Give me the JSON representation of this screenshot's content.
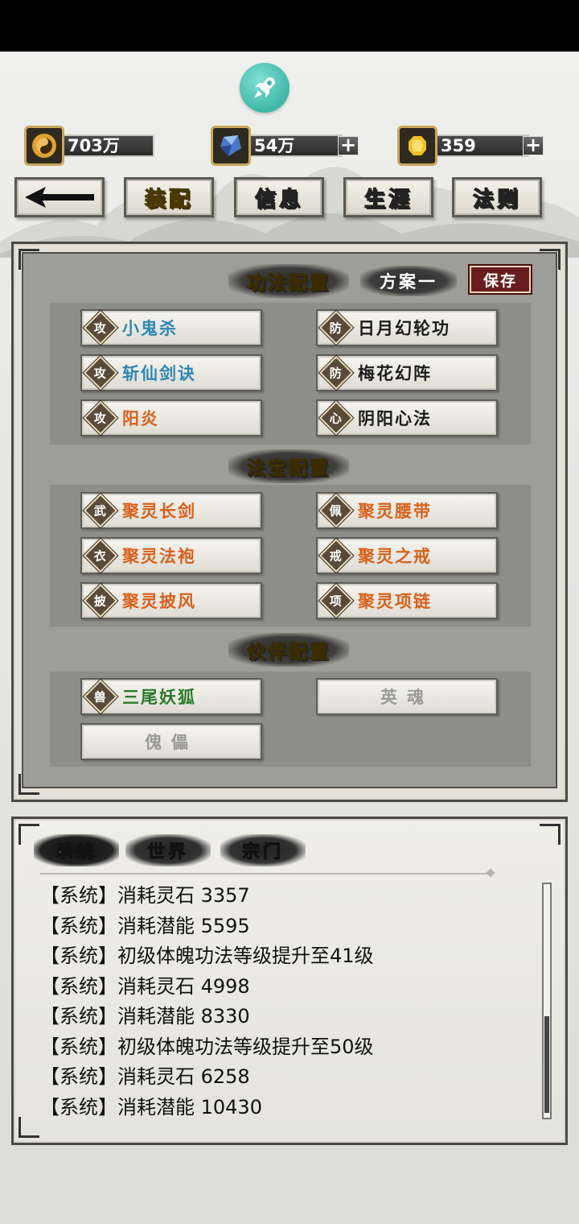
{
  "resources": [
    {
      "icon": "taiji-coin-icon",
      "value": "703万",
      "has_plus": false
    },
    {
      "icon": "blue-crystal-icon",
      "value": "54万",
      "has_plus": true
    },
    {
      "icon": "gold-gem-icon",
      "value": "359",
      "has_plus": true
    }
  ],
  "nav": {
    "back_icon": "back-arrow-icon",
    "tabs": [
      "装配",
      "信息",
      "生涯",
      "法则"
    ],
    "active_tab": "装配"
  },
  "config": {
    "skills_title": "功法配置",
    "plan_label": "方案一",
    "save_label": "保存",
    "skills": [
      {
        "badge": "攻",
        "name": "小鬼杀",
        "color": "#2f88b5"
      },
      {
        "badge": "防",
        "name": "日月幻轮功",
        "color": "#1c1c1c"
      },
      {
        "badge": "攻",
        "name": "斩仙剑诀",
        "color": "#2f88b5"
      },
      {
        "badge": "防",
        "name": "梅花幻阵",
        "color": "#1c1c1c"
      },
      {
        "badge": "攻",
        "name": "阳炎",
        "color": "#d8601a"
      },
      {
        "badge": "心",
        "name": "阴阳心法",
        "color": "#1c1c1c"
      }
    ],
    "treasure_title": "法宝配置",
    "treasures": [
      {
        "badge": "武",
        "name": "聚灵长剑",
        "color": "#d8601a"
      },
      {
        "badge": "佩",
        "name": "聚灵腰带",
        "color": "#d8601a"
      },
      {
        "badge": "衣",
        "name": "聚灵法袍",
        "color": "#d8601a"
      },
      {
        "badge": "戒",
        "name": "聚灵之戒",
        "color": "#d8601a"
      },
      {
        "badge": "披",
        "name": "聚灵披风",
        "color": "#d8601a"
      },
      {
        "badge": "项",
        "name": "聚灵项链",
        "color": "#d8601a"
      }
    ],
    "partner_title": "伙伴配置",
    "partners": [
      {
        "badge": "兽",
        "name": "三尾妖狐",
        "color": "#2a7a2a"
      },
      {
        "badge": "",
        "name": "英魂",
        "color": "#9a9a96"
      },
      {
        "badge": "",
        "name": "傀儡",
        "color": "#9a9a96"
      }
    ]
  },
  "chat": {
    "tabs": [
      "系统",
      "世界",
      "宗门"
    ],
    "active_tab": "系统",
    "messages": [
      "【系统】消耗灵石 3357",
      "【系统】消耗潜能 5595",
      "【系统】初级体魄功法等级提升至41级",
      "【系统】消耗灵石 4998",
      "【系统】消耗潜能 8330",
      "【系统】初级体魄功法等级提升至50级",
      "【系统】消耗灵石 6258",
      "【系统】消耗潜能 10430"
    ]
  }
}
